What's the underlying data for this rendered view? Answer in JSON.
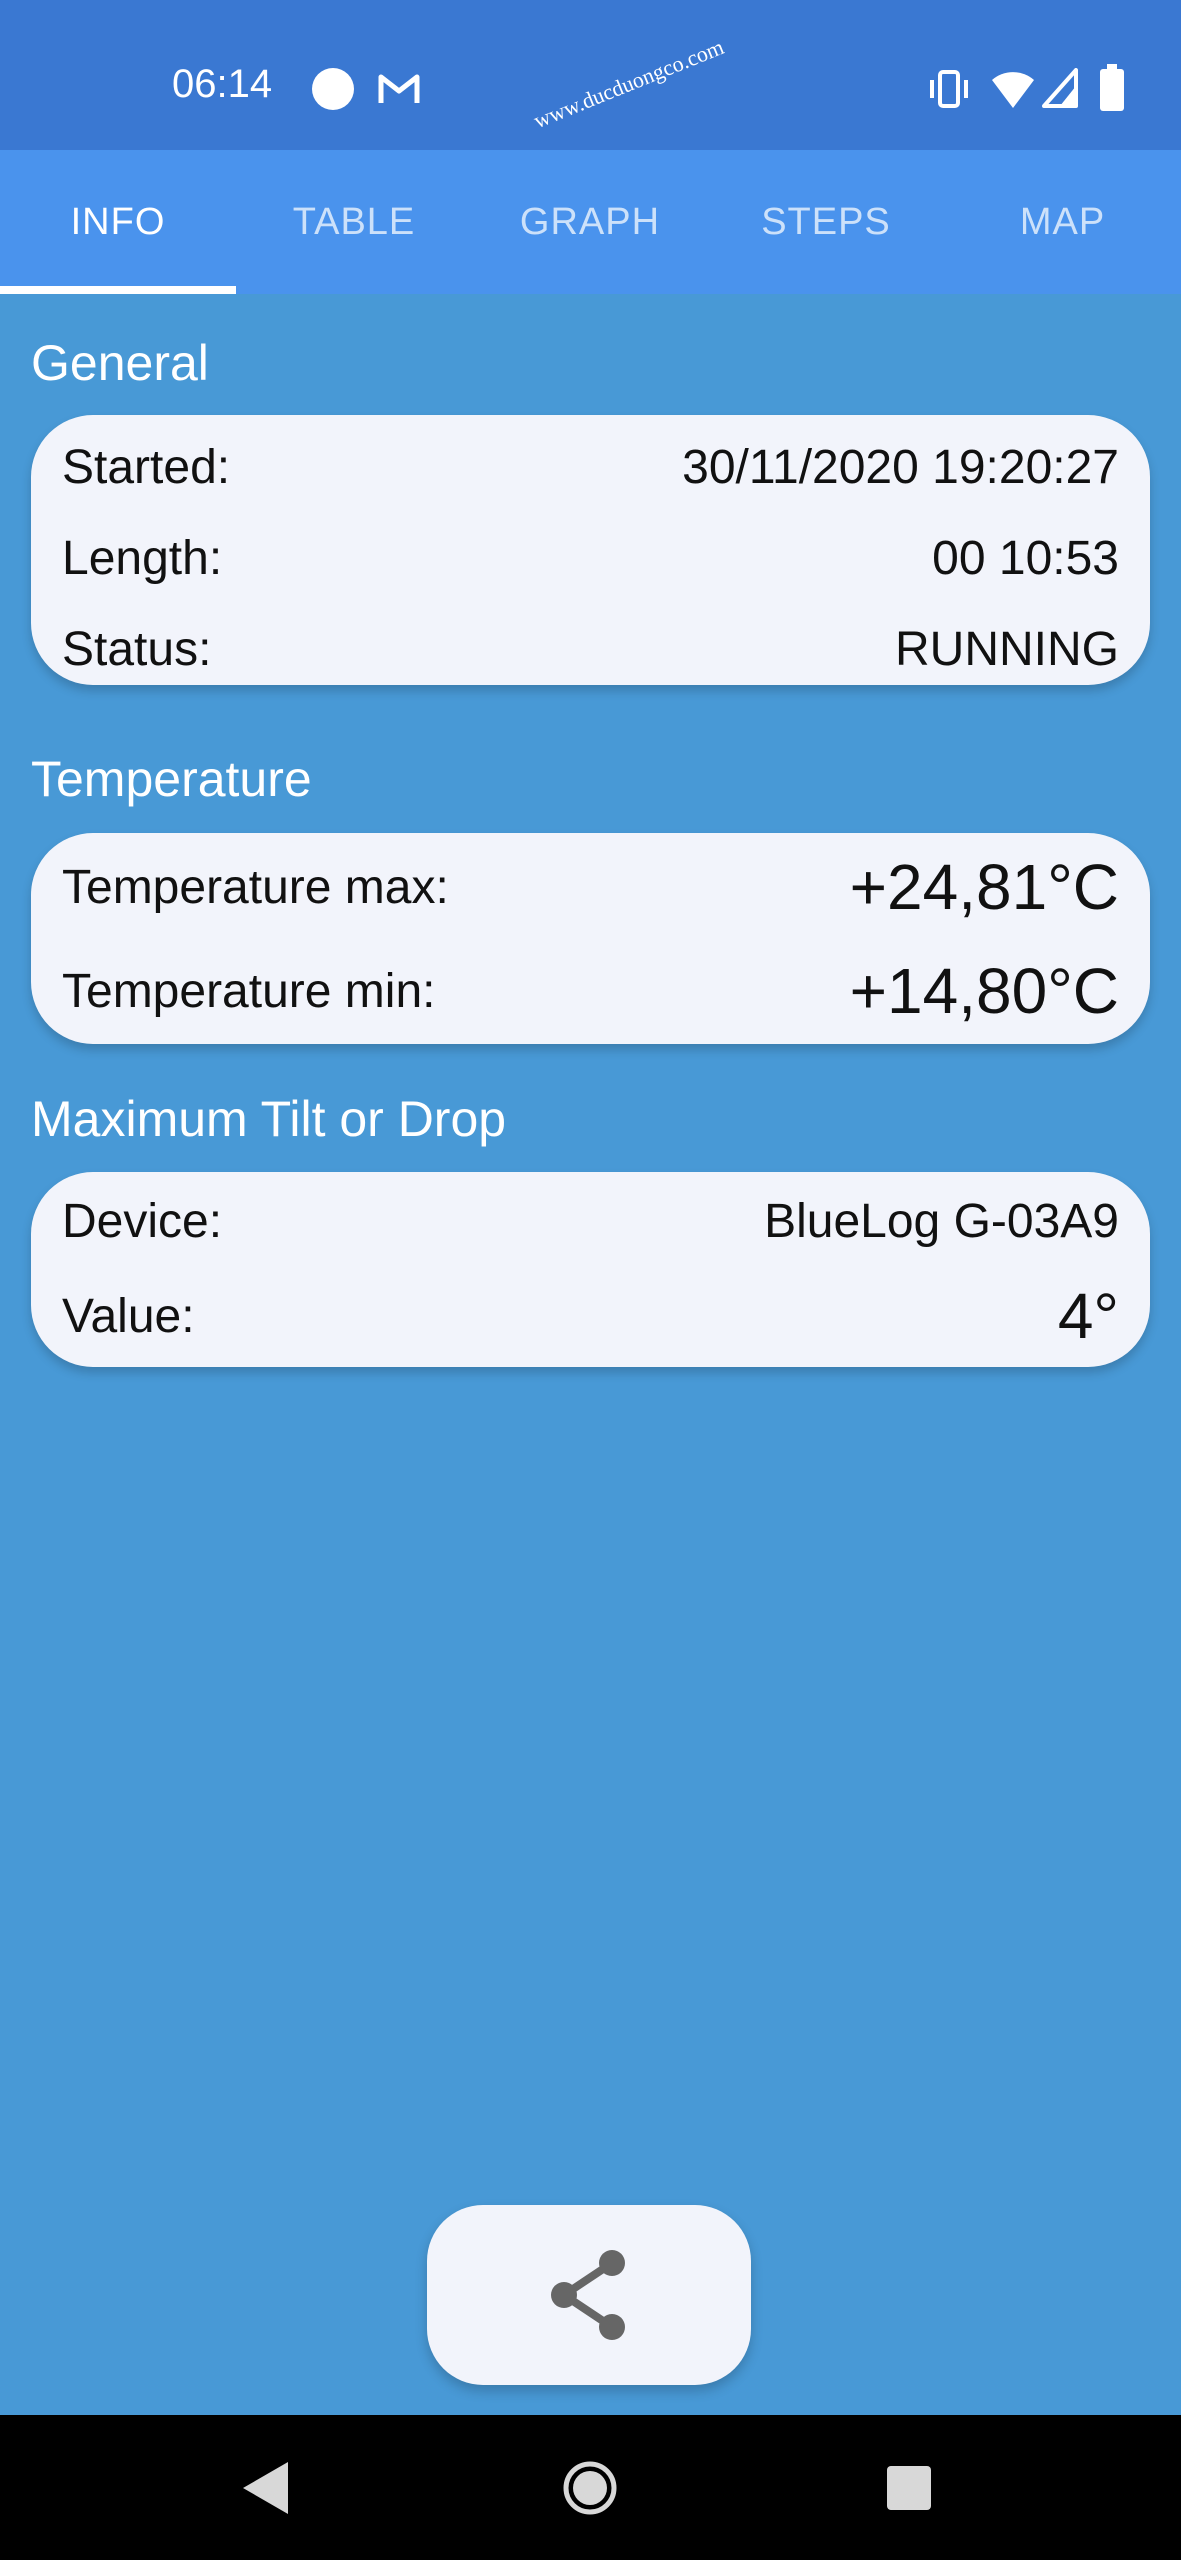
{
  "status_bar": {
    "time": "06:14",
    "icons": [
      "dot-icon",
      "gmail-icon",
      "vibrate-icon",
      "wifi-icon",
      "signal-icon",
      "battery-icon"
    ],
    "watermark": "www.ducduongco.com"
  },
  "tabs": [
    {
      "label": "INFO",
      "active": true
    },
    {
      "label": "TABLE",
      "active": false
    },
    {
      "label": "GRAPH",
      "active": false
    },
    {
      "label": "STEPS",
      "active": false
    },
    {
      "label": "MAP",
      "active": false
    }
  ],
  "general": {
    "title": "General",
    "started_label": "Started:",
    "started_value": "30/11/2020 19:20:27",
    "length_label": "Length:",
    "length_value": "00 10:53",
    "status_label": "Status:",
    "status_value": "RUNNING"
  },
  "temperature": {
    "title": "Temperature",
    "max_label": "Temperature max:",
    "max_value": "+24,81°C",
    "min_label": "Temperature min:",
    "min_value": "+14,80°C"
  },
  "tilt": {
    "title": "Maximum Tilt or Drop",
    "device_label": "Device:",
    "device_value": "BlueLog G-03A9",
    "value_label": "Value:",
    "value_value": "4°"
  },
  "share": {
    "icon": "share-icon"
  },
  "nav": {
    "icons": [
      "back-icon",
      "home-icon",
      "recents-icon"
    ]
  },
  "colors": {
    "status_bar": "#3a78d2",
    "tab_bar": "#4a93ed",
    "background": "#4899d6",
    "card": "#f2f4fb"
  }
}
